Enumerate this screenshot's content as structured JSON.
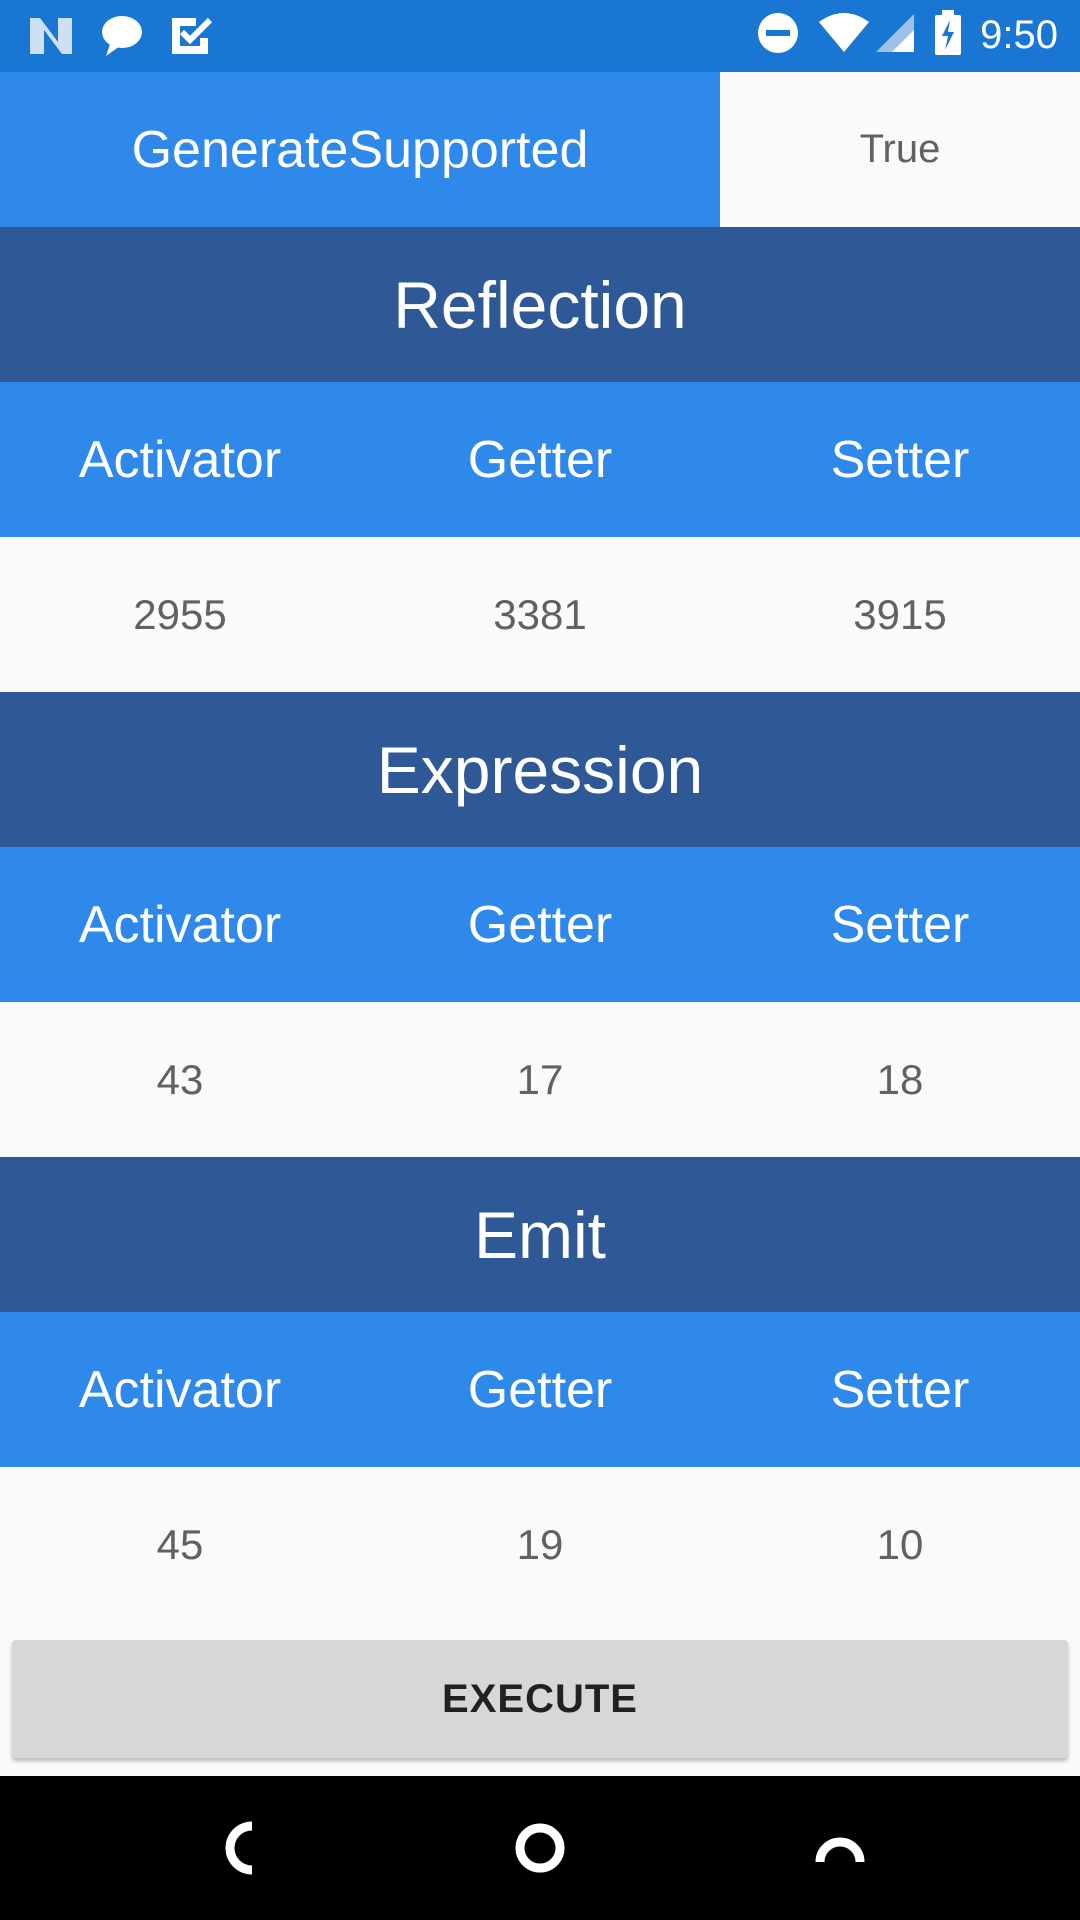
{
  "status_bar": {
    "time": "9:50",
    "icons_left": [
      "n-logo-icon",
      "chat-bubble-icon",
      "task-check-icon"
    ],
    "icons_right": [
      "do-not-disturb-icon",
      "wifi-icon",
      "cell-signal-icon",
      "battery-charging-icon"
    ]
  },
  "top": {
    "label": "GenerateSupported",
    "value": "True"
  },
  "sections": [
    {
      "title": "Reflection",
      "headers": [
        "Activator",
        "Getter",
        "Setter"
      ],
      "values": [
        "2955",
        "3381",
        "3915"
      ]
    },
    {
      "title": "Expression",
      "headers": [
        "Activator",
        "Getter",
        "Setter"
      ],
      "values": [
        "43",
        "17",
        "18"
      ]
    },
    {
      "title": "Emit",
      "headers": [
        "Activator",
        "Getter",
        "Setter"
      ],
      "values": [
        "45",
        "19",
        "10"
      ]
    }
  ],
  "execute_label": "EXECUTE",
  "nav": {
    "icons": [
      "back-icon",
      "home-icon",
      "recents-icon"
    ]
  },
  "colors": {
    "status_bar": "#1976d2",
    "primary": "#2e89ea",
    "section_title": "#2e5896",
    "background": "#fafafa",
    "button": "#d6d7d7"
  }
}
